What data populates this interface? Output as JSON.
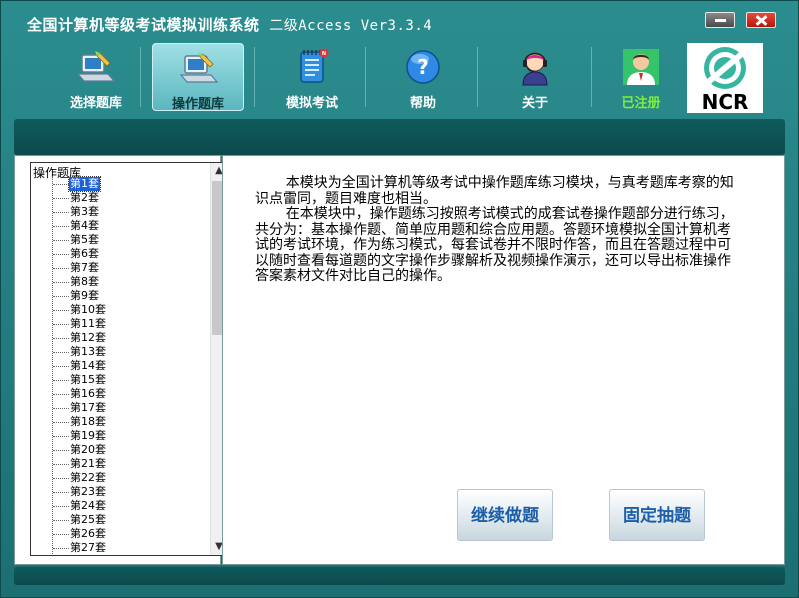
{
  "window": {
    "title": "全国计算机等级考试模拟训练系统",
    "subtitle": "二级Access  Ver3.3.4"
  },
  "toolbar": {
    "items": [
      {
        "label": "选择题库",
        "icon": "computer-pencil-icon"
      },
      {
        "label": "操作题库",
        "icon": "computer-pencil-icon",
        "active": true
      },
      {
        "label": "模拟考试",
        "icon": "notepad-new-icon"
      },
      {
        "label": "帮助",
        "icon": "help-question-icon"
      },
      {
        "label": "关于",
        "icon": "person-headset-icon"
      },
      {
        "label": "已注册",
        "icon": "registered-user-icon"
      }
    ],
    "logo_text": "NCR"
  },
  "tree": {
    "root": "操作题库",
    "items": [
      "第1套",
      "第2套",
      "第3套",
      "第4套",
      "第5套",
      "第6套",
      "第7套",
      "第8套",
      "第9套",
      "第10套",
      "第11套",
      "第12套",
      "第13套",
      "第14套",
      "第15套",
      "第16套",
      "第17套",
      "第18套",
      "第19套",
      "第20套",
      "第21套",
      "第22套",
      "第23套",
      "第24套",
      "第25套",
      "第26套",
      "第27套"
    ],
    "selected_index": 0
  },
  "content": {
    "paragraphs": [
      "本模块为全国计算机等级考试中操作题库练习模块，与真考题库考察的知识点雷同，题目难度也相当。",
      "在本模块中，操作题练习按照考试模式的成套试卷操作题部分进行练习，共分为：基本操作题、简单应用题和综合应用题。答题环境模拟全国计算机考试的考试环境，作为练习模式，每套试卷并不限时作答，而且在答题过程中可以随时查看每道题的文字操作步骤解析及视频操作演示，还可以导出标准操作答案素材文件对比自己的操作。"
    ],
    "continue_button": "继续做题",
    "fixed_button": "固定抽题"
  },
  "colors": {
    "frame": "#1b6f72",
    "accent": "#1c5fa8",
    "selection": "#1e60d8",
    "registered": "#7ff03a"
  }
}
